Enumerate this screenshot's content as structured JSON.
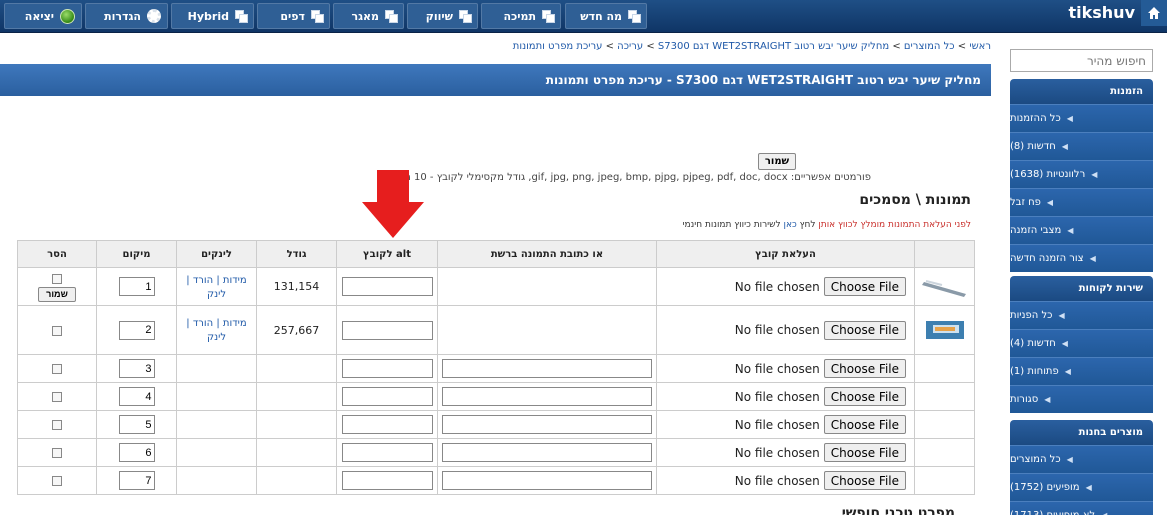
{
  "app": {
    "brand": "tikshuv"
  },
  "topnav": [
    {
      "label": "מה חדש",
      "icon": "pages-icon"
    },
    {
      "label": "תמיכה",
      "icon": "pages-icon"
    },
    {
      "label": "שיווק",
      "icon": "pages-icon"
    },
    {
      "label": "מאגר",
      "icon": "pages-icon"
    },
    {
      "label": "דפים",
      "icon": "pages-icon"
    },
    {
      "label": "Hybrid",
      "icon": "pages-icon"
    },
    {
      "label": "הגדרות",
      "icon": "gear-icon"
    },
    {
      "label": "יציאה",
      "icon": "globe-icon"
    }
  ],
  "breadcrumb": {
    "home": "ראשי",
    "products": "כל המוצרים",
    "product": "מחליק שיער יבש רטוב WET2STRAIGHT דגם S7300",
    "edit": "עריכה",
    "current": "עריכת מפרט ותמונות",
    "separator": ">"
  },
  "page_title": "מחליק שיער יבש רטוב WET2STRAIGHT דגם S7300 - עריכת מפרט ותמונות",
  "search": {
    "placeholder": "חיפוש מהיר"
  },
  "sidebar": {
    "orders": {
      "title": "הזמנות",
      "items": [
        "כל ההזמנות",
        "חדשות (8)",
        "רלוונטיות (1638)",
        "פח זבל",
        "מצבי הזמנה",
        "צור הזמנה חדשה"
      ]
    },
    "customers": {
      "title": "שירות לקוחות",
      "items": [
        "כל הפניות",
        "חדשות (4)",
        "פתוחות (1)",
        "סגורות"
      ]
    },
    "store": {
      "title": "מוצרים בחנות",
      "items": [
        "כל המוצרים",
        "מופיעים (1752)",
        "לא מופיעים (1713)"
      ]
    }
  },
  "save_label": "שמור",
  "formats_text": "פורמטים אפשריים: gif, jpg, png, jpeg, bmp, pjpg, pjpeg, pdf, doc, docx, גודל מקסימלי לקובץ - 10 מגה",
  "section_title": "תמונות \\ מסמכים",
  "warning": {
    "before_red": "לפני העלאת התמונות מומלץ לכווץ אותן",
    "click": " לחץ ",
    "link": "כאן",
    "after": " לשירות כיווץ תמונות חינמי"
  },
  "table": {
    "headers": [
      "העלאת קובץ",
      "או כתובת התמונה ברשת",
      "alt לקובץ",
      "גודל",
      "לינקים",
      "מיקום",
      "הסר"
    ],
    "choose_label": "Choose File",
    "no_file_label": "No file chosen",
    "rows": [
      {
        "size": "131,154",
        "links": "מידות | הורד | לינק",
        "position": "1",
        "has_image": true
      },
      {
        "size": "257,667",
        "links": "מידות | הורד | לינק",
        "position": "2",
        "has_image": true
      },
      {
        "size": "",
        "links": "",
        "position": "3",
        "has_image": false
      },
      {
        "size": "",
        "links": "",
        "position": "4",
        "has_image": false
      },
      {
        "size": "",
        "links": "",
        "position": "5",
        "has_image": false
      },
      {
        "size": "",
        "links": "",
        "position": "6",
        "has_image": false
      },
      {
        "size": "",
        "links": "",
        "position": "7",
        "has_image": false
      }
    ]
  },
  "bottom_title": "מפרט טכני חופשי",
  "colors": {
    "nav": "#1f4f86",
    "title_bar": "#3f78bd",
    "sidebar": "#2c66ad",
    "link": "#1f59a8",
    "warning_red": "#c9302c",
    "arrow": "#e61e1e"
  }
}
